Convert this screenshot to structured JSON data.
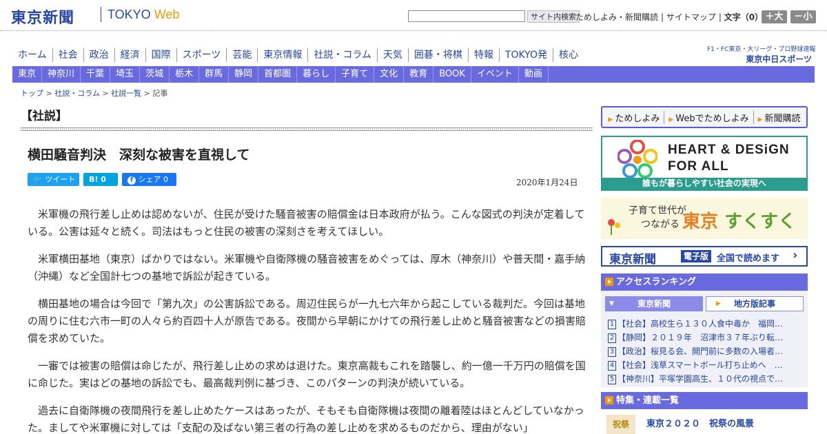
{
  "header": {
    "logo_jp": "東京新聞",
    "logo_tokyo": "TOKYO",
    "logo_web": "Web",
    "search_button": "サイト内検索",
    "links": [
      "ためしよみ・新聞購読",
      "サイトマップ"
    ],
    "font_label": "文字（0）",
    "font_plus": "＋大",
    "font_minus": "－小"
  },
  "main_nav": [
    "ホーム",
    "社会",
    "政治",
    "経済",
    "国際",
    "スポーツ",
    "芸能",
    "東京情報",
    "社説・コラム",
    "天気",
    "囲碁・将棋",
    "特報",
    "TOKYO発",
    "核心"
  ],
  "chunichi": {
    "top": "F1・FC東京・大リーグ・プロ野球速報",
    "bottom": "東京中日スポーツ"
  },
  "region_nav": [
    "東京",
    "神奈川",
    "千葉",
    "埼玉",
    "茨城",
    "栃木",
    "群馬",
    "静岡",
    "首都圏",
    "暮らし",
    "子育て",
    "文化",
    "教育",
    "BOOK",
    "イベント",
    "動画"
  ],
  "breadcrumb": {
    "items": [
      "トップ",
      "社説・コラム",
      "社説一覧"
    ],
    "current": "記事"
  },
  "article": {
    "section": "【社説】",
    "title": "横田騒音判決　深刻な被害を直視して",
    "date": "2020年1月24日",
    "share": {
      "tweet": "ツイート",
      "hatena": "B!  0",
      "facebook": "シェア 0"
    },
    "paragraphs": [
      "米軍機の飛行差し止めは認めないが、住民が受けた騒音被害の賠償金は日本政府が払う。こんな図式の判決が定着している。公害は延々と続く。司法はもっと住民の被害の深刻さを考えてほしい。",
      "米軍横田基地（東京）ばかりではない。米軍機や自衛隊機の騒音被害をめぐっては、厚木（神奈川）や普天間・嘉手納（沖縄）など全国計七つの基地で訴訟が起きている。",
      "横田基地の場合は今回で「第九次」の公害訴訟である。周辺住民らが一九七六年から起こしている裁判だ。今回は基地の周りに住む六市一町の人々ら約百四十人が原告である。夜間から早朝にかけての飛行差し止めと騒音被害などの損害賠償を求めていた。",
      "一審では被害の賠償は命じたが、飛行差し止めの求めは退けた。東京高裁もこれを踏襲し、約一億一千万円の賠償を国に命じた。実はどの基地の訴訟でも、最高裁判例に基づき、このパターンの判決が続いている。",
      "過去に自衛隊機の夜間飛行を差し止めたケースはあったが、そもそも自衛隊機は夜間の離着陸はほとんどしていなかった。ましてや米軍機に対しては「支配の及ばない第三者の行為の差し止めを求めるものだから、理由がない」"
    ]
  },
  "sidebar": {
    "promo_links": [
      "ためしよみ",
      "Webでためしよみ",
      "新聞購読"
    ],
    "hd_banner": {
      "title1": "HEART & DESiGN",
      "title2": "FOR ALL",
      "foot": "誰もが暮らしやすい社会の実現へ"
    },
    "sukusuku": {
      "line1": "子育て世代が",
      "line2": "つながる",
      "logo_a": "東京",
      "logo_b": "すくすく"
    },
    "denshi": {
      "logo": "東京新聞",
      "badge": "電子版",
      "text": "全国で読めます"
    },
    "ranking": {
      "heading": "アクセスランキング",
      "tab_active": "東京新聞",
      "tab_active_icon": "▼",
      "tab_inactive": "地方版記事",
      "items": [
        {
          "num": "1",
          "text": "【社会】高校生ら１３０人食中毒か　福岡…"
        },
        {
          "num": "2",
          "text": "【静岡】２０１９年　沼津市３７年ぶり転…"
        },
        {
          "num": "3",
          "text": "【政治】桜見る会、開門前に多数の入場者…"
        },
        {
          "num": "4",
          "text": "【社会】浅草スマートボール打ち止めへ　…"
        },
        {
          "num": "5",
          "text": "【神奈川】平塚学園高生、１０代の視点で…"
        }
      ]
    },
    "tokushu": {
      "heading": "特集・連載一覧",
      "thumb": "祝祭",
      "title": "東京２０２０　祝祭の風景"
    }
  },
  "colors": {
    "brand_blue": "#2646a8",
    "nav_purple": "#6a6ae0",
    "accent_orange": "#f39800",
    "hd_teal": "#2a9d8f"
  }
}
